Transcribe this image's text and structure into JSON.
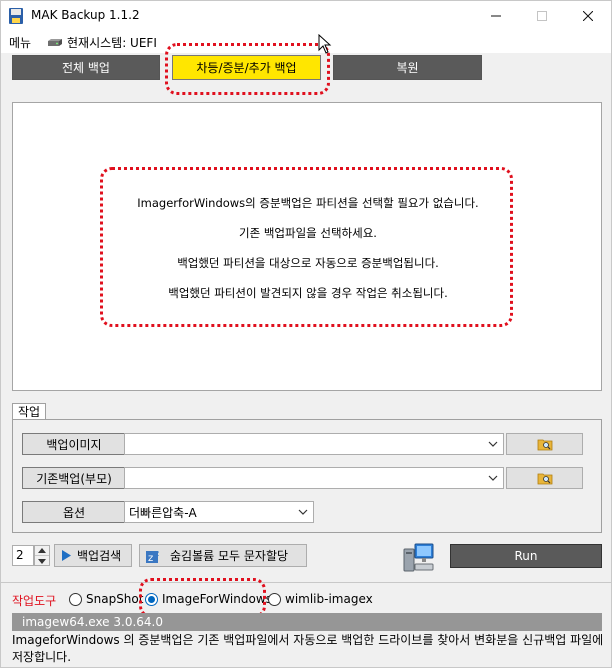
{
  "window": {
    "title": "MAK Backup 1.1.2"
  },
  "menu": {
    "main": "메뉴",
    "system": "현재시스템: UEFI"
  },
  "tabs": [
    {
      "label": "전체 백업",
      "active": false
    },
    {
      "label": "차등/증분/추가 백업",
      "active": true
    },
    {
      "label": "복원",
      "active": false
    }
  ],
  "info": {
    "line1": "ImagerforWindows의 증분백업은 파티션을 선택할 필요가 없습니다.",
    "line2": "기존 백업파일을 선택하세요.",
    "line3": "백업했던 파티션을 대상으로 자동으로 증분백업됩니다.",
    "line4": "백업했던 파티션이 발견되지 않을 경우 작업은 취소됩니다."
  },
  "task": {
    "group_label": "작업",
    "image_label": "백업이미지",
    "image_value": "",
    "parent_label": "기존백업(부모)",
    "parent_value": "",
    "option_label": "옵션",
    "option_value": "더빠른압축-A"
  },
  "toolbar": {
    "count": "2",
    "search_label": "백업검색",
    "assign_label": "숨김볼륨 모두 문자할당",
    "run_label": "Run"
  },
  "tools": {
    "label": "작업도구",
    "options": [
      "SnapShot",
      "ImageForWindows",
      "wimlib-imagex"
    ],
    "selected": "ImageForWindows"
  },
  "status": {
    "version": "imagew64.exe 3.0.64.0",
    "description": "ImageforWindows 의 증분백업은 기존 백업파일에서 자동으로 백업한 드라이브를 찾아서 변화분을 신규백업 파일에 저장합니다."
  },
  "colors": {
    "accent_yellow": "#ffe600",
    "highlight_red": "#e0101e",
    "dark_button": "#5a5a5a",
    "radio_blue": "#0067c0"
  }
}
